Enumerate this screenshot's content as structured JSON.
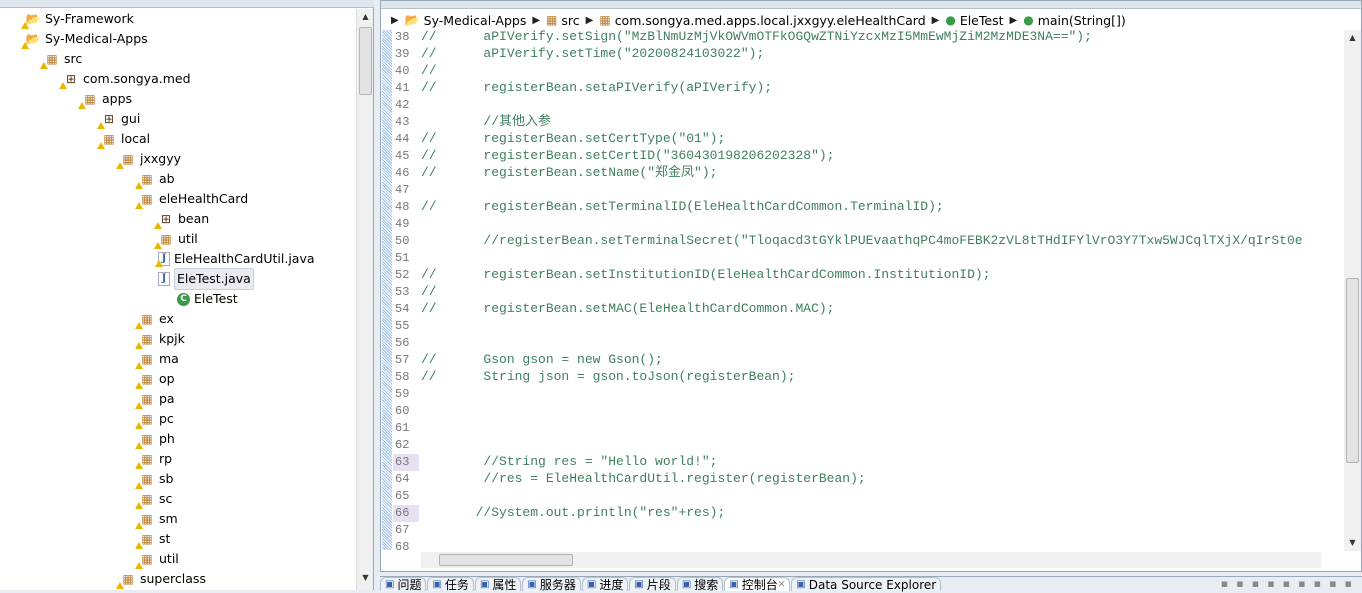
{
  "explorer": {
    "tree": [
      {
        "label": "Sy-Framework",
        "depth": 0,
        "icon": "project-icon"
      },
      {
        "label": "Sy-Medical-Apps",
        "depth": 0,
        "icon": "project-icon"
      },
      {
        "label": "src",
        "depth": 1,
        "icon": "source-folder-icon"
      },
      {
        "label": "com.songya.med",
        "depth": 2,
        "icon": "package-icon"
      },
      {
        "label": "apps",
        "depth": 3,
        "icon": "package-folder-icon"
      },
      {
        "label": "gui",
        "depth": 4,
        "icon": "package-icon"
      },
      {
        "label": "local",
        "depth": 4,
        "icon": "package-folder-icon"
      },
      {
        "label": "jxxgyy",
        "depth": 5,
        "icon": "package-folder-icon"
      },
      {
        "label": "ab",
        "depth": 6,
        "icon": "package-folder-icon"
      },
      {
        "label": "eleHealthCard",
        "depth": 6,
        "icon": "package-folder-icon"
      },
      {
        "label": "bean",
        "depth": 7,
        "icon": "package-icon"
      },
      {
        "label": "util",
        "depth": 7,
        "icon": "package-folder-icon"
      },
      {
        "label": "EleHealthCardUtil.java",
        "depth": 7,
        "icon": "java-file-icon"
      },
      {
        "label": "EleTest.java",
        "depth": 7,
        "icon": "java-file-icon",
        "selected": true
      },
      {
        "label": "EleTest",
        "depth": 8,
        "icon": "class-icon"
      },
      {
        "label": "ex",
        "depth": 6,
        "icon": "package-folder-icon"
      },
      {
        "label": "kpjk",
        "depth": 6,
        "icon": "package-folder-icon"
      },
      {
        "label": "ma",
        "depth": 6,
        "icon": "package-folder-icon"
      },
      {
        "label": "op",
        "depth": 6,
        "icon": "package-folder-icon"
      },
      {
        "label": "pa",
        "depth": 6,
        "icon": "package-folder-icon"
      },
      {
        "label": "pc",
        "depth": 6,
        "icon": "package-folder-icon"
      },
      {
        "label": "ph",
        "depth": 6,
        "icon": "package-folder-icon"
      },
      {
        "label": "rp",
        "depth": 6,
        "icon": "package-folder-icon"
      },
      {
        "label": "sb",
        "depth": 6,
        "icon": "package-folder-icon"
      },
      {
        "label": "sc",
        "depth": 6,
        "icon": "package-folder-icon"
      },
      {
        "label": "sm",
        "depth": 6,
        "icon": "package-folder-icon"
      },
      {
        "label": "st",
        "depth": 6,
        "icon": "package-folder-icon"
      },
      {
        "label": "util",
        "depth": 6,
        "icon": "package-folder-icon"
      },
      {
        "label": "superclass",
        "depth": 5,
        "icon": "package-folder-icon"
      }
    ]
  },
  "breadcrumb": [
    "Sy-Medical-Apps",
    "src",
    "com.songya.med.apps.local.jxxgyy.eleHealthCard",
    "EleTest",
    "main(String[])"
  ],
  "code": [
    {
      "n": "38",
      "t": "//      aPIVerify.setSign(\"MzBlNmUzMjVkOWVmOTFkOGQwZTNiYzcxMzI5MmEwMjZiM2MzMDE3NA==\");"
    },
    {
      "n": "39",
      "t": "//      aPIVerify.setTime(\"20200824103022\");"
    },
    {
      "n": "40",
      "t": "//"
    },
    {
      "n": "41",
      "t": "//      registerBean.setaPIVerify(aPIVerify);"
    },
    {
      "n": "42",
      "t": ""
    },
    {
      "n": "43",
      "t": "        //其他入参"
    },
    {
      "n": "44",
      "t": "//      registerBean.setCertType(\"01\");"
    },
    {
      "n": "45",
      "t": "//      registerBean.setCertID(\"360430198206202328\");"
    },
    {
      "n": "46",
      "t": "//      registerBean.setName(\"郑金凤\");"
    },
    {
      "n": "47",
      "t": ""
    },
    {
      "n": "48",
      "t": "//      registerBean.setTerminalID(EleHealthCardCommon.TerminalID);"
    },
    {
      "n": "49",
      "t": ""
    },
    {
      "n": "50",
      "t": "        //registerBean.setTerminalSecret(\"Tloqacd3tGYklPUEvaathqPC4moFEBK2zVL8tTHdIFYlVrO3Y7Txw5WJCqlTXjX/qIrSt0e"
    },
    {
      "n": "51",
      "t": ""
    },
    {
      "n": "52",
      "t": "//      registerBean.setInstitutionID(EleHealthCardCommon.InstitutionID);"
    },
    {
      "n": "53",
      "t": "//"
    },
    {
      "n": "54",
      "t": "//      registerBean.setMAC(EleHealthCardCommon.MAC);"
    },
    {
      "n": "55",
      "t": ""
    },
    {
      "n": "56",
      "t": ""
    },
    {
      "n": "57",
      "t": "//      Gson gson = new Gson();"
    },
    {
      "n": "58",
      "t": "//      String json = gson.toJson(registerBean);"
    },
    {
      "n": "59",
      "t": ""
    },
    {
      "n": "60",
      "t": ""
    },
    {
      "n": "61",
      "t": ""
    },
    {
      "n": "62",
      "t": ""
    },
    {
      "n": "63",
      "t": "        //String res = \"Hello world!\";",
      "hl": true
    },
    {
      "n": "64",
      "t": "        //res = EleHealthCardUtil.register(registerBean);"
    },
    {
      "n": "65",
      "t": ""
    },
    {
      "n": "66",
      "t": "       //System.out.println(\"res\"+res);",
      "hl": true
    },
    {
      "n": "67",
      "t": ""
    },
    {
      "n": "68",
      "t": ""
    }
  ],
  "bottom_tabs": [
    "问题",
    "任务",
    "属性",
    "服务器",
    "进度",
    "片段",
    "搜索",
    "控制台",
    "Data Source Explorer"
  ],
  "active_bottom_tab": "控制台",
  "colors": {
    "comment": "#3f7f5f",
    "selection": "#e8ecf2"
  }
}
